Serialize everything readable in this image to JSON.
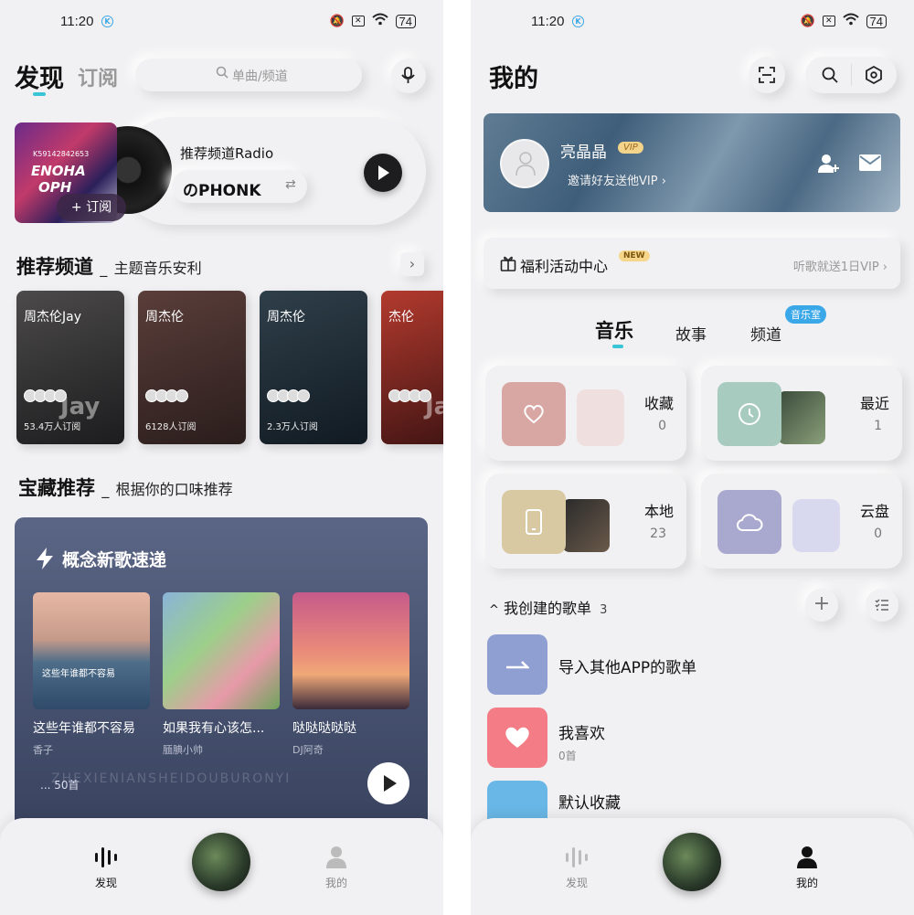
{
  "status": {
    "time": "11:20",
    "k_badge": "K",
    "battery": "74"
  },
  "left": {
    "tabs": {
      "discover": "发现",
      "subscribe": "订阅"
    },
    "search": {
      "placeholder": "单曲/频道"
    },
    "radio": {
      "title": "推荐频道Radio",
      "station": "のPHONK",
      "subscribe_label": "+ 订阅",
      "cover_text_1": "K59142842653",
      "cover_text_2": "ENOHA",
      "cover_text_3": "OPH"
    },
    "rec_channels": {
      "title": "推荐频道",
      "sep": "_",
      "subtitle": "主题音乐安利",
      "cards": [
        {
          "name": "周杰伦Jay",
          "subs": "53.4万人订阅",
          "watermark": "Jay",
          "color1": "#4c4a4a",
          "color2": "#1c1c1e"
        },
        {
          "name": "周杰伦",
          "subs": "6128人订阅",
          "watermark": "",
          "color1": "#5a3e3a",
          "color2": "#2a1d1c"
        },
        {
          "name": "周杰伦",
          "subs": "2.3万人订阅",
          "watermark": "",
          "color1": "#2f3f4a",
          "color2": "#111a22"
        },
        {
          "name": "杰伦",
          "subs": "",
          "watermark": "Jay",
          "color1": "#b33a2e",
          "color2": "#3a1212"
        }
      ]
    },
    "treasure": {
      "title": "宝藏推荐",
      "sep": "_",
      "subtitle": "根据你的口味推荐",
      "panel_title": "概念新歌速递",
      "songs": [
        {
          "title": "这些年谁都不容易",
          "artist": "香子",
          "cover_caption": "这些年谁都不容易"
        },
        {
          "title": "如果我有心该怎...",
          "artist": "腼腆小帅"
        },
        {
          "title": "哒哒哒哒哒",
          "artist": "DJ阿奇"
        }
      ],
      "more": "... 50首",
      "bg_text": "ZHEXIENIANSHEIDOUBURONYI"
    },
    "nav": {
      "discover": "发现",
      "mine": "我的"
    }
  },
  "right": {
    "title": "我的",
    "profile": {
      "name": "亮晶晶",
      "vip_badge": "VIP",
      "invite": "邀请好友送他VIP ›"
    },
    "welfare": {
      "label": "福利活动中心",
      "new_badge": "NEW",
      "hint": "听歌就送1日VIP ›"
    },
    "tabs": {
      "music": "音乐",
      "story": "故事",
      "channel": "频道",
      "music_room": "音乐室"
    },
    "tiles": [
      {
        "label": "收藏",
        "count": "0",
        "color": "#d9a7a3"
      },
      {
        "label": "最近",
        "count": "1",
        "color": "#a8cbbf"
      },
      {
        "label": "本地",
        "count": "23",
        "color": "#d9c9a3"
      },
      {
        "label": "云盘",
        "count": "0",
        "color": "#a9a9cf"
      }
    ],
    "playlists": {
      "title": "我创建的歌单",
      "count": "3",
      "expand": "^",
      "items": [
        {
          "title": "导入其他APP的歌单",
          "sub": "",
          "color": "#8f9fd1"
        },
        {
          "title": "我喜欢",
          "sub": "0首",
          "color": "#f47c86"
        },
        {
          "title": "默认收藏",
          "sub": "",
          "color": "#69b7e6"
        }
      ]
    },
    "nav": {
      "discover": "发现",
      "mine": "我的"
    }
  }
}
